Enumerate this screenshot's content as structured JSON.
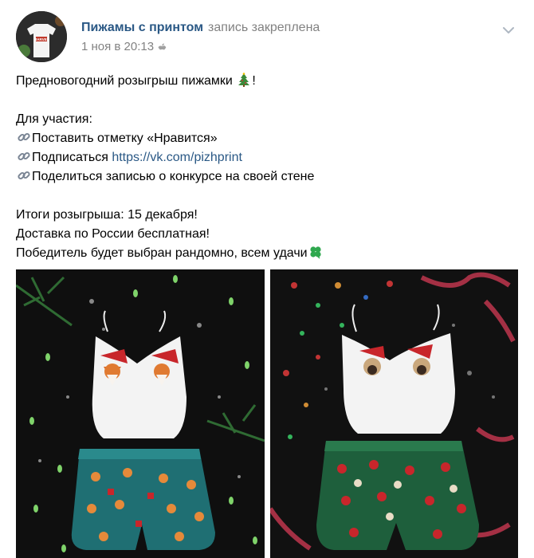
{
  "header": {
    "group_name": "Пижамы с принтом",
    "pinned_label": "запись закреплена",
    "date": "1 ноя в 20:13"
  },
  "post": {
    "title": "Предновогодний розыгрыш пижамки",
    "participation_heading": "Для участия:",
    "steps": [
      "Поставить отметку «Нравится»",
      "Подписаться",
      "Поделиться записью о конкурсе на своей стене"
    ],
    "subscribe_link": "https://vk.com/pizhprint",
    "result_line": "Итоги розыгрыша: 15 декабря!",
    "delivery_line": "Доставка по России бесплатная!",
    "winner_line": "Победитель будет выбран рандомно, всем удачи",
    "title_suffix": "!"
  },
  "avatar": {
    "shirt_text": "MARVEL"
  },
  "colors": {
    "link": "#2a5885",
    "muted": "#828282",
    "shorts_left": "#1f6f73",
    "shorts_right": "#1e5f3c"
  },
  "icons": [
    "christmas-tree-icon",
    "link-icon",
    "clover-icon",
    "apple-icon",
    "chevron-down-icon"
  ]
}
